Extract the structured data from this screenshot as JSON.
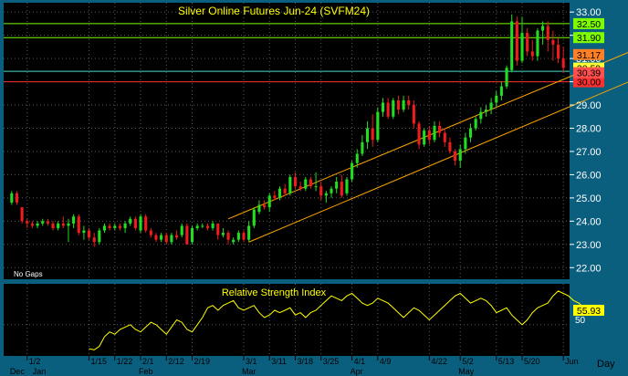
{
  "chart_data": [
    {
      "type": "candlestick",
      "title": "Silver Online Futures Jun-24 (SVFM24)",
      "note": "No Gaps",
      "ylim": [
        21.5,
        33.4
      ],
      "y_ticks": [
        "22.00",
        "23.00",
        "24.00",
        "25.00",
        "26.00",
        "27.00",
        "28.00",
        "29.00",
        "30.00",
        "31.00",
        "32.00",
        "33.00"
      ],
      "horizontal_lines": [
        {
          "value": 32.5,
          "label": "32.50",
          "color": "#7cfc00"
        },
        {
          "value": 31.9,
          "label": "31.90",
          "color": "#7cfc00"
        },
        {
          "value": 30.45,
          "label": "30.45",
          "color": "#40e0d0"
        },
        {
          "value": 30.0,
          "label": "30.00",
          "color": "#ff3030"
        }
      ],
      "price_labels": [
        {
          "value": 31.17,
          "label": "31.17",
          "bg": "#ff7f27"
        },
        {
          "value": 30.59,
          "label": "30.59",
          "bg": "#ffff33"
        },
        {
          "value": 30.39,
          "label": "30.39",
          "bg": "#ff5050"
        }
      ],
      "trend_channel": {
        "color": "#ffa500",
        "upper": {
          "from": [
            42,
            24.1
          ],
          "to": [
            120,
            31.3
          ]
        },
        "lower": {
          "from": [
            46,
            23.1
          ],
          "to": [
            124,
            30.4
          ]
        }
      },
      "ohlc": [
        [
          24.8,
          25.3,
          24.7,
          25.2
        ],
        [
          25.2,
          25.3,
          24.7,
          24.8
        ],
        [
          24.6,
          24.6,
          23.9,
          24.0
        ],
        [
          24.0,
          24.1,
          23.7,
          23.9
        ],
        [
          23.9,
          24.0,
          23.7,
          23.8
        ],
        [
          23.8,
          24.0,
          23.7,
          23.9
        ],
        [
          23.9,
          24.1,
          23.8,
          24.0
        ],
        [
          24.0,
          24.1,
          23.8,
          23.9
        ],
        [
          23.9,
          24.0,
          23.6,
          23.7
        ],
        [
          23.7,
          24.0,
          23.6,
          23.9
        ],
        [
          23.9,
          24.2,
          23.7,
          23.8
        ],
        [
          23.8,
          24.1,
          23.1,
          23.9
        ],
        [
          23.9,
          24.3,
          23.7,
          24.2
        ],
        [
          24.2,
          24.3,
          23.4,
          23.5
        ],
        [
          23.5,
          23.8,
          23.2,
          23.6
        ],
        [
          23.6,
          23.7,
          23.2,
          23.3
        ],
        [
          23.3,
          23.5,
          22.9,
          23.1
        ],
        [
          23.1,
          23.7,
          23.0,
          23.6
        ],
        [
          23.6,
          23.9,
          23.5,
          23.8
        ],
        [
          23.8,
          23.9,
          23.6,
          23.7
        ],
        [
          23.7,
          23.9,
          23.6,
          23.8
        ],
        [
          23.8,
          23.9,
          23.6,
          23.7
        ],
        [
          23.7,
          24.0,
          23.5,
          23.9
        ],
        [
          23.9,
          24.2,
          23.8,
          24.1
        ],
        [
          24.1,
          24.2,
          23.6,
          23.7
        ],
        [
          23.6,
          24.3,
          23.5,
          24.2
        ],
        [
          24.2,
          24.3,
          23.5,
          23.6
        ],
        [
          23.6,
          23.7,
          23.3,
          23.4
        ],
        [
          23.4,
          23.5,
          23.1,
          23.2
        ],
        [
          23.2,
          23.5,
          23.1,
          23.4
        ],
        [
          23.4,
          23.5,
          23.0,
          23.1
        ],
        [
          23.1,
          23.5,
          23.0,
          23.4
        ],
        [
          23.4,
          23.6,
          23.2,
          23.3
        ],
        [
          23.4,
          23.9,
          23.3,
          23.8
        ],
        [
          23.8,
          23.9,
          23.0,
          23.0
        ],
        [
          23.1,
          23.8,
          23.0,
          23.7
        ],
        [
          23.7,
          23.9,
          23.6,
          23.8
        ],
        [
          23.8,
          23.9,
          23.7,
          23.8
        ],
        [
          23.8,
          23.9,
          23.6,
          23.7
        ],
        [
          23.7,
          24.0,
          23.6,
          23.9
        ],
        [
          23.9,
          23.9,
          23.2,
          23.4
        ],
        [
          23.4,
          23.7,
          23.3,
          23.5
        ],
        [
          23.5,
          23.6,
          23.0,
          23.2
        ],
        [
          23.1,
          23.3,
          23.0,
          23.2
        ],
        [
          23.2,
          23.6,
          23.1,
          23.5
        ],
        [
          23.5,
          23.6,
          23.1,
          23.2
        ],
        [
          23.2,
          24.0,
          23.1,
          23.8
        ],
        [
          23.8,
          24.6,
          23.7,
          24.5
        ],
        [
          24.4,
          24.9,
          24.3,
          24.7
        ],
        [
          24.7,
          24.9,
          24.5,
          24.6
        ],
        [
          24.6,
          25.2,
          24.4,
          25.1
        ],
        [
          25.1,
          25.3,
          24.9,
          25.0
        ],
        [
          25.0,
          25.5,
          24.9,
          25.4
        ],
        [
          25.4,
          25.6,
          25.1,
          25.2
        ],
        [
          25.2,
          26.0,
          25.1,
          25.9
        ],
        [
          25.9,
          26.1,
          25.4,
          25.5
        ],
        [
          25.5,
          25.7,
          25.3,
          25.4
        ],
        [
          25.4,
          25.9,
          25.3,
          25.8
        ],
        [
          25.8,
          25.9,
          25.4,
          25.5
        ],
        [
          25.5,
          26.1,
          25.3,
          25.5
        ],
        [
          25.5,
          25.7,
          24.9,
          25.1
        ],
        [
          25.1,
          25.3,
          24.8,
          25.2
        ],
        [
          25.2,
          25.5,
          25.0,
          25.4
        ],
        [
          25.4,
          25.9,
          25.2,
          25.7
        ],
        [
          25.7,
          26.0,
          25.0,
          25.1
        ],
        [
          25.2,
          25.9,
          25.1,
          25.8
        ],
        [
          25.8,
          26.6,
          25.7,
          26.5
        ],
        [
          26.5,
          27.1,
          26.3,
          26.9
        ],
        [
          26.9,
          27.7,
          26.8,
          27.4
        ],
        [
          27.4,
          28.3,
          27.1,
          28.0
        ],
        [
          28.0,
          28.6,
          27.2,
          27.5
        ],
        [
          27.5,
          28.9,
          27.4,
          28.7
        ],
        [
          28.7,
          29.3,
          28.5,
          29.1
        ],
        [
          29.1,
          29.3,
          28.4,
          28.5
        ],
        [
          28.5,
          29.3,
          28.4,
          29.2
        ],
        [
          29.2,
          29.4,
          28.6,
          28.8
        ],
        [
          28.8,
          29.4,
          28.7,
          29.2
        ],
        [
          29.2,
          29.4,
          28.8,
          29.0
        ],
        [
          29.0,
          29.2,
          28.0,
          28.2
        ],
        [
          28.2,
          28.3,
          27.1,
          27.3
        ],
        [
          27.3,
          28.0,
          27.2,
          27.9
        ],
        [
          27.9,
          28.1,
          27.3,
          27.5
        ],
        [
          27.5,
          28.3,
          27.4,
          28.1
        ],
        [
          28.1,
          28.3,
          27.6,
          27.8
        ],
        [
          27.8,
          28.0,
          27.2,
          27.4
        ],
        [
          27.4,
          27.6,
          26.9,
          27.0
        ],
        [
          27.0,
          27.1,
          26.4,
          26.6
        ],
        [
          26.6,
          27.3,
          26.3,
          27.1
        ],
        [
          27.1,
          27.8,
          26.9,
          27.6
        ],
        [
          27.6,
          28.2,
          27.4,
          28.0
        ],
        [
          28.0,
          28.5,
          27.9,
          28.4
        ],
        [
          28.4,
          28.9,
          28.2,
          28.7
        ],
        [
          28.7,
          29.0,
          28.5,
          28.8
        ],
        [
          28.8,
          29.3,
          28.6,
          29.1
        ],
        [
          29.1,
          29.6,
          28.9,
          29.4
        ],
        [
          29.4,
          30.0,
          29.2,
          29.8
        ],
        [
          29.8,
          30.7,
          29.7,
          30.6
        ],
        [
          30.5,
          32.9,
          30.4,
          32.6
        ],
        [
          32.6,
          32.8,
          30.7,
          30.9
        ],
        [
          30.9,
          32.8,
          30.8,
          32.1
        ],
        [
          32.1,
          32.3,
          31.1,
          31.3
        ],
        [
          31.3,
          31.8,
          30.9,
          31.1
        ],
        [
          31.1,
          32.3,
          30.9,
          32.2
        ],
        [
          32.2,
          32.6,
          31.6,
          32.4
        ],
        [
          32.4,
          32.6,
          31.3,
          31.8
        ],
        [
          31.8,
          32.2,
          30.9,
          31.6
        ],
        [
          31.6,
          31.9,
          30.8,
          31.0
        ],
        [
          31.0,
          31.5,
          30.4,
          30.6
        ]
      ],
      "x_ticks": [
        {
          "i": 3,
          "label": "1/2"
        },
        {
          "i": 15,
          "label": "1/15"
        },
        {
          "i": 20,
          "label": "1/22"
        },
        {
          "i": 25,
          "label": "2/1"
        },
        {
          "i": 30,
          "label": "2/12"
        },
        {
          "i": 35,
          "label": "2/19"
        },
        {
          "i": 45,
          "label": "3/1"
        },
        {
          "i": 50,
          "label": "3/11"
        },
        {
          "i": 55,
          "label": "3/18"
        },
        {
          "i": 60,
          "label": "3/25"
        },
        {
          "i": 66,
          "label": "4/1"
        },
        {
          "i": 71,
          "label": "4/9"
        },
        {
          "i": 81,
          "label": "4/22"
        },
        {
          "i": 87,
          "label": "5/2"
        },
        {
          "i": 94,
          "label": "5/13"
        },
        {
          "i": 99,
          "label": "5/20"
        },
        {
          "i": 107,
          "label": "Jun"
        }
      ],
      "month_labels": [
        "Dec",
        "Jan",
        "Feb",
        "Mar",
        "Apr",
        "May"
      ]
    },
    {
      "type": "line",
      "title": "Relative Strength Index",
      "ylim": [
        37,
        67
      ],
      "y_ticks": [
        "50"
      ],
      "last_value_label": "55.93",
      "values": [
        40.0,
        39.5,
        41.0,
        45.0,
        47.0,
        46.0,
        48.0,
        49.0,
        50.0,
        48.0,
        47.0,
        49.0,
        51.0,
        50.0,
        48.0,
        46.0,
        49.0,
        52.0,
        51.0,
        48.0,
        47.0,
        50.0,
        53.0,
        57.0,
        58.0,
        56.0,
        58.0,
        59.0,
        60.0,
        57.0,
        56.0,
        57.0,
        58.0,
        55.0,
        53.0,
        54.0,
        56.0,
        55.0,
        56.0,
        57.0,
        54.0,
        55.0,
        53.0,
        55.0,
        56.0,
        58.0,
        60.0,
        62.0,
        61.0,
        60.0,
        62.0,
        63.0,
        61.0,
        59.0,
        58.0,
        59.0,
        61.0,
        60.0,
        59.0,
        57.0,
        55.0,
        53.0,
        55.0,
        57.0,
        56.0,
        54.0,
        52.0,
        54.0,
        56.0,
        58.0,
        60.0,
        62.0,
        63.0,
        61.0,
        59.0,
        60.0,
        61.0,
        60.0,
        58.0,
        55.0,
        56.0,
        57.0,
        54.0,
        52.0,
        50.0,
        52.0,
        55.0,
        57.0,
        58.0,
        59.0,
        62.0,
        64.0,
        63.0,
        62.0,
        60.0,
        59.0,
        57.0,
        56.0
      ],
      "value_x_start": 15,
      "period_label": "Day"
    }
  ],
  "colors": {
    "up": "#22dd22",
    "down": "#ee1c1c",
    "axis": "#ffffff",
    "accent": "#ffff00"
  }
}
